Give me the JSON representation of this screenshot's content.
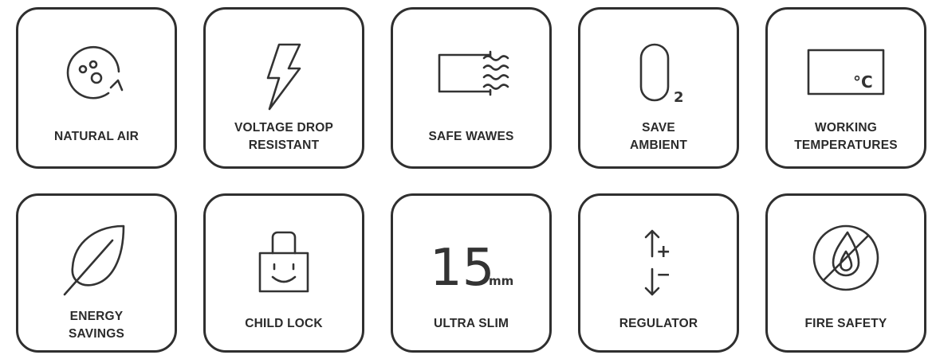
{
  "row1": [
    {
      "lines": [
        "NATURAL AIR"
      ],
      "icon": "natural-air-icon"
    },
    {
      "lines": [
        "VOLTAGE DROP",
        "RESISTANT"
      ],
      "icon": "lightning-bolt-icon"
    },
    {
      "lines": [
        "SAFE WAWES"
      ],
      "icon": "safe-waves-icon"
    },
    {
      "lines": [
        "SAVE",
        "AMBIENT"
      ],
      "icon": "oxygen-o2-icon"
    },
    {
      "lines": [
        "WORKING",
        "TEMPERATURES"
      ],
      "icon": "temperature-celsius-icon"
    }
  ],
  "row2": [
    {
      "lines": [
        "ENERGY",
        "SAVINGS"
      ],
      "icon": "leaf-icon"
    },
    {
      "lines": [
        "CHILD LOCK"
      ],
      "icon": "padlock-smile-icon"
    },
    {
      "lines": [
        "ULTRA SLIM"
      ],
      "icon": "ultra-slim-15mm-icon"
    },
    {
      "lines": [
        "REGULATOR"
      ],
      "icon": "up-down-arrows-plus-minus-icon"
    },
    {
      "lines": [
        "FIRE SAFETY"
      ],
      "icon": "no-fire-icon"
    }
  ],
  "icon_text": {
    "o2_big": "O",
    "o2_sub": "2",
    "celsius": "°C",
    "slim_num": "15",
    "slim_unit": "mm",
    "plus": "+",
    "minus": "−"
  }
}
